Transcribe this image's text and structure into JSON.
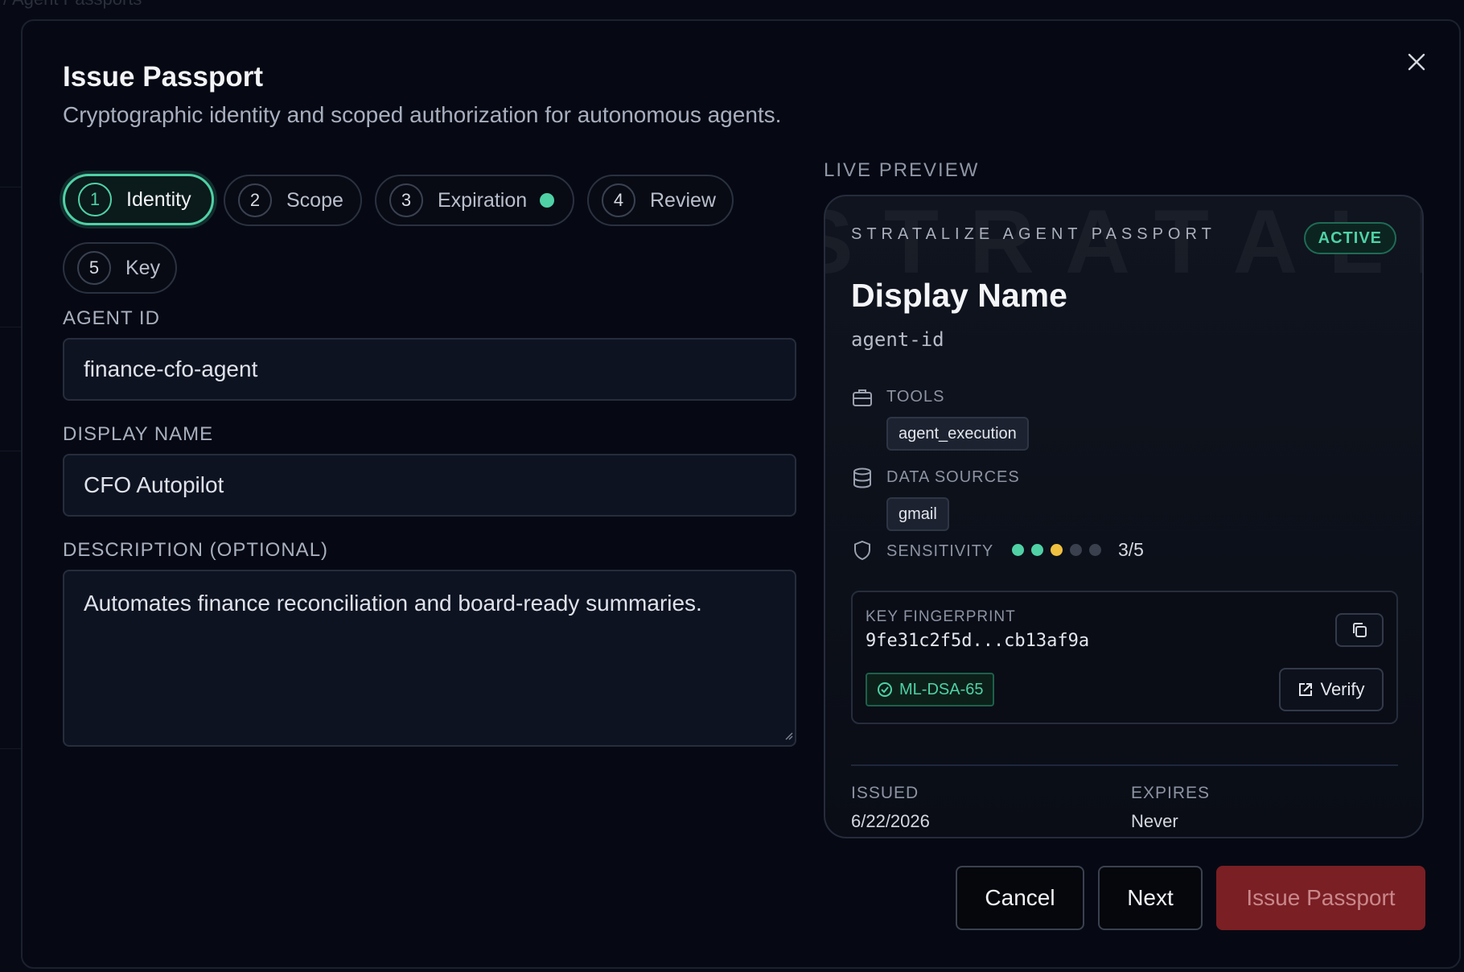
{
  "background": {
    "breadcrumb": "/ Agent Passports"
  },
  "modal": {
    "title": "Issue Passport",
    "subtitle": "Cryptographic identity and scoped authorization for autonomous agents.",
    "close_icon": "close-icon"
  },
  "steps": [
    {
      "number": "1",
      "label": "Identity",
      "state": "active"
    },
    {
      "number": "2",
      "label": "Scope",
      "state": "default"
    },
    {
      "number": "3",
      "label": "Expiration",
      "state": "complete-dot"
    },
    {
      "number": "4",
      "label": "Review",
      "state": "default"
    },
    {
      "number": "5",
      "label": "Key",
      "state": "default"
    }
  ],
  "form": {
    "agent_id": {
      "label": "AGENT ID",
      "value": "finance-cfo-agent"
    },
    "display_name": {
      "label": "DISPLAY NAME",
      "value": "CFO Autopilot"
    },
    "description": {
      "label": "DESCRIPTION (OPTIONAL)",
      "value": "Automates finance reconciliation and board-ready summaries."
    }
  },
  "preview": {
    "section_label": "LIVE PREVIEW",
    "watermark": "STRATALIZE",
    "brand": "STRATALIZE AGENT PASSPORT",
    "status": "ACTIVE",
    "display_name": "Display Name",
    "agent_id": "agent-id",
    "tools": {
      "label": "TOOLS",
      "icon": "briefcase-icon",
      "items": [
        "agent_execution"
      ]
    },
    "data_sources": {
      "label": "DATA SOURCES",
      "icon": "database-icon",
      "items": [
        "gmail"
      ]
    },
    "sensitivity": {
      "label": "SENSITIVITY",
      "icon": "shield-icon",
      "level": 3,
      "max": 5,
      "value_text": "3/5"
    },
    "fingerprint": {
      "label": "KEY FINGERPRINT",
      "value": "9fe31c2f5d...cb13af9a",
      "algorithm": "ML-DSA-65",
      "verify_label": "Verify"
    },
    "issued": {
      "label": "ISSUED",
      "value": "6/22/2026"
    },
    "expires": {
      "label": "EXPIRES",
      "value": "Never"
    }
  },
  "footer": {
    "cancel_label": "Cancel",
    "next_label": "Next",
    "issue_label": "Issue Passport"
  },
  "colors": {
    "accent": "#4fd1a5",
    "sensitivity_mid": "#f0c040",
    "danger": "#7a1f24",
    "sensitivity_off": "#3a404d"
  }
}
